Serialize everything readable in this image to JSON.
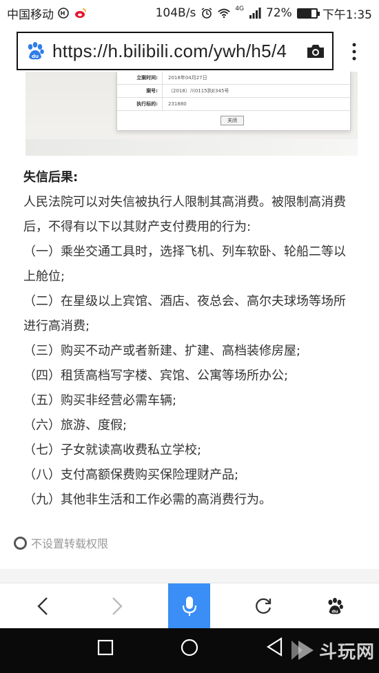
{
  "status_bar": {
    "carrier": "中国移动",
    "speed": "104B/s",
    "network": "4G",
    "battery": "72%",
    "battery_level": 0.72,
    "time": "下午1:35"
  },
  "browser": {
    "url": "https://h.bilibili.com/ywh/h5/4"
  },
  "record": {
    "rows": [
      {
        "label": "立案时间:",
        "value": "2018年04月27日"
      },
      {
        "label": "案号:",
        "value": "（2018）川0115执E345号"
      },
      {
        "label": "执行标的:",
        "value": "231880"
      }
    ],
    "close_label": "关闭"
  },
  "article": {
    "heading": "失信后果:",
    "intro": "人民法院可以对失信被执行人限制其高消费。被限制高消费后，不得有以下以其财产支付费用的行为:",
    "items": [
      "（一）乘坐交通工具时，选择飞机、列车软卧、轮船二等以上舱位;",
      "（二）在星级以上宾馆、酒店、夜总会、高尔夫球场等场所进行高消费;",
      "（三）购买不动产或者新建、扩建、高档装修房屋;",
      "（四）租赁高档写字楼、宾馆、公寓等场所办公;",
      "（五）购买非经营必需车辆;",
      "（六）旅游、度假;",
      "（七）子女就读高收费私立学校;",
      "（八）支付高额保费购买保险理财产品;",
      "（九）其他非生活和工作必需的高消费行为。"
    ]
  },
  "repost": {
    "label": "不设置转载权限"
  },
  "watermark": {
    "text": "斗玩网"
  },
  "colors": {
    "accent": "#3a8ef6",
    "paw": "#2f7de8"
  }
}
